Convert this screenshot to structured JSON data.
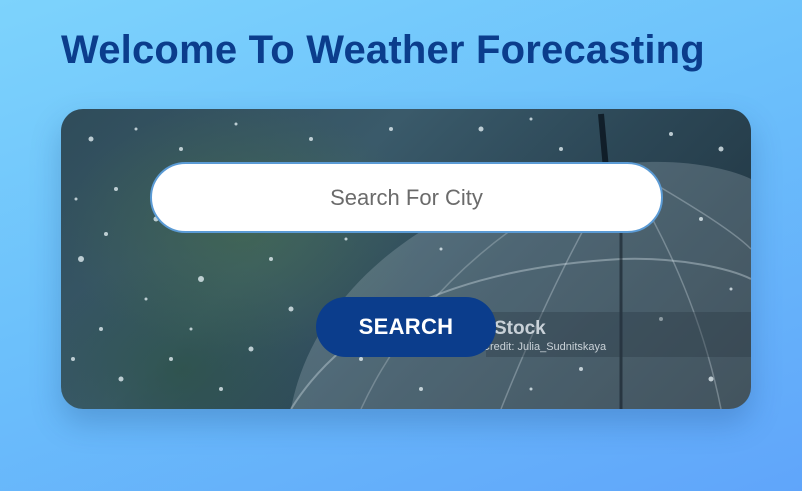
{
  "page": {
    "title": "Welcome To Weather Forecasting"
  },
  "search": {
    "placeholder": "Search For City",
    "value": "",
    "button_label": "SEARCH"
  },
  "background_image": {
    "subject": "rain-umbrella-photo",
    "watermark_brand": "Stock",
    "watermark_credit": "Credit: Julia_Sudnitskaya"
  },
  "colors": {
    "page_gradient_start": "#7dd3fc",
    "page_gradient_end": "#60a5fa",
    "title": "#0b3d8c",
    "button": "#0b3d8c",
    "button_text": "#ffffff",
    "input_border": "#5b9bd5"
  }
}
